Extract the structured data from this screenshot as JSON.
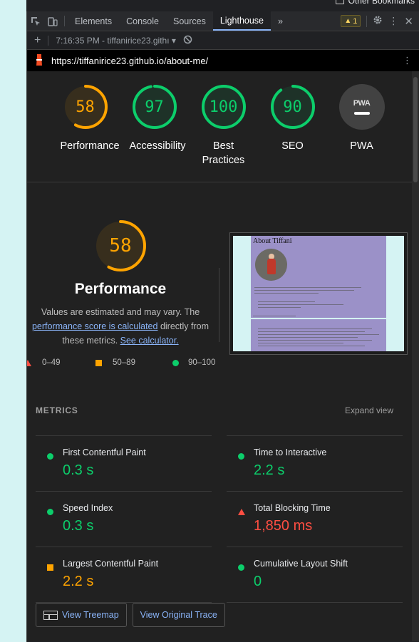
{
  "browser": {
    "bookmarks_label": "Other Bookmarks"
  },
  "devtools": {
    "tabs": [
      {
        "label": "Elements",
        "active": false
      },
      {
        "label": "Console",
        "active": false
      },
      {
        "label": "Sources",
        "active": false
      },
      {
        "label": "Lighthouse",
        "active": true
      }
    ],
    "more_tabs": "»",
    "warnings_count": "1",
    "session": "7:16:35 PM - tiffanirice23.githı",
    "url": "https://tiffanirice23.github.io/about-me/"
  },
  "gauges": [
    {
      "score": "58",
      "label": "Performance",
      "score_pct": 58,
      "color": "#ffa400"
    },
    {
      "score": "97",
      "label": "Accessibility",
      "score_pct": 97,
      "color": "#0cce6b"
    },
    {
      "score": "100",
      "label": "Best Practices",
      "score_pct": 100,
      "color": "#0cce6b"
    },
    {
      "score": "90",
      "label": "SEO",
      "score_pct": 90,
      "color": "#0cce6b"
    },
    {
      "label": "PWA",
      "badge": "PWA"
    }
  ],
  "performance": {
    "score": "58",
    "score_pct": 58,
    "title": "Performance",
    "desc_1": "Values are estimated and may vary. The",
    "link_score": "performance score is calculated",
    "desc_2": " directly from",
    "desc_3": "these metrics. ",
    "link_calc": "See calculator.",
    "legend": {
      "fail": "0–49",
      "average": "50–89",
      "pass": "90–100"
    },
    "screenshot_title": "About Tiffani"
  },
  "metrics": {
    "heading": "METRICS",
    "expand_label": "Expand view",
    "items": [
      {
        "name": "First Contentful Paint",
        "value": "0.3 s",
        "rating": "pass"
      },
      {
        "name": "Time to Interactive",
        "value": "2.2 s",
        "rating": "pass"
      },
      {
        "name": "Speed Index",
        "value": "0.3 s",
        "rating": "pass"
      },
      {
        "name": "Total Blocking Time",
        "value": "1,850 ms",
        "rating": "fail"
      },
      {
        "name": "Largest Contentful Paint",
        "value": "2.2 s",
        "rating": "average"
      },
      {
        "name": "Cumulative Layout Shift",
        "value": "0",
        "rating": "pass"
      }
    ]
  },
  "actions": {
    "treemap": "View Treemap",
    "trace": "View Original Trace"
  },
  "colors": {
    "pass": "#0cce6b",
    "average": "#ffa400",
    "fail": "#ff4e42",
    "link": "#8ab4f8"
  }
}
